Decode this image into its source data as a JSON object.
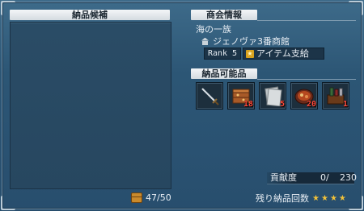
{
  "left_panel": {
    "header": "納品候補",
    "capacity": "47/50"
  },
  "guild_info": {
    "header": "商会情報",
    "guild_name": "海の一族",
    "shop_name": "ジェノヴァ3番商館",
    "rank": "Rank 5",
    "supply": "アイテム支給"
  },
  "deliverable": {
    "header": "納品可能品",
    "items": [
      {
        "icon": "sword-icon",
        "qty": ""
      },
      {
        "icon": "crate-icon",
        "qty": "18"
      },
      {
        "icon": "paper-icon",
        "qty": "5"
      },
      {
        "icon": "food-plate-icon",
        "qty": "20"
      },
      {
        "icon": "bottle-crate-icon",
        "qty": "1"
      }
    ]
  },
  "contribution": {
    "label": "貢献度",
    "value": "0/",
    "max": "230"
  },
  "remaining": {
    "label": "残り納品回数",
    "stars": 4
  },
  "colors": {
    "header_bg": "#e6ebef",
    "qty_red": "#ff4a3a",
    "star_gold": "#f2c23a"
  }
}
